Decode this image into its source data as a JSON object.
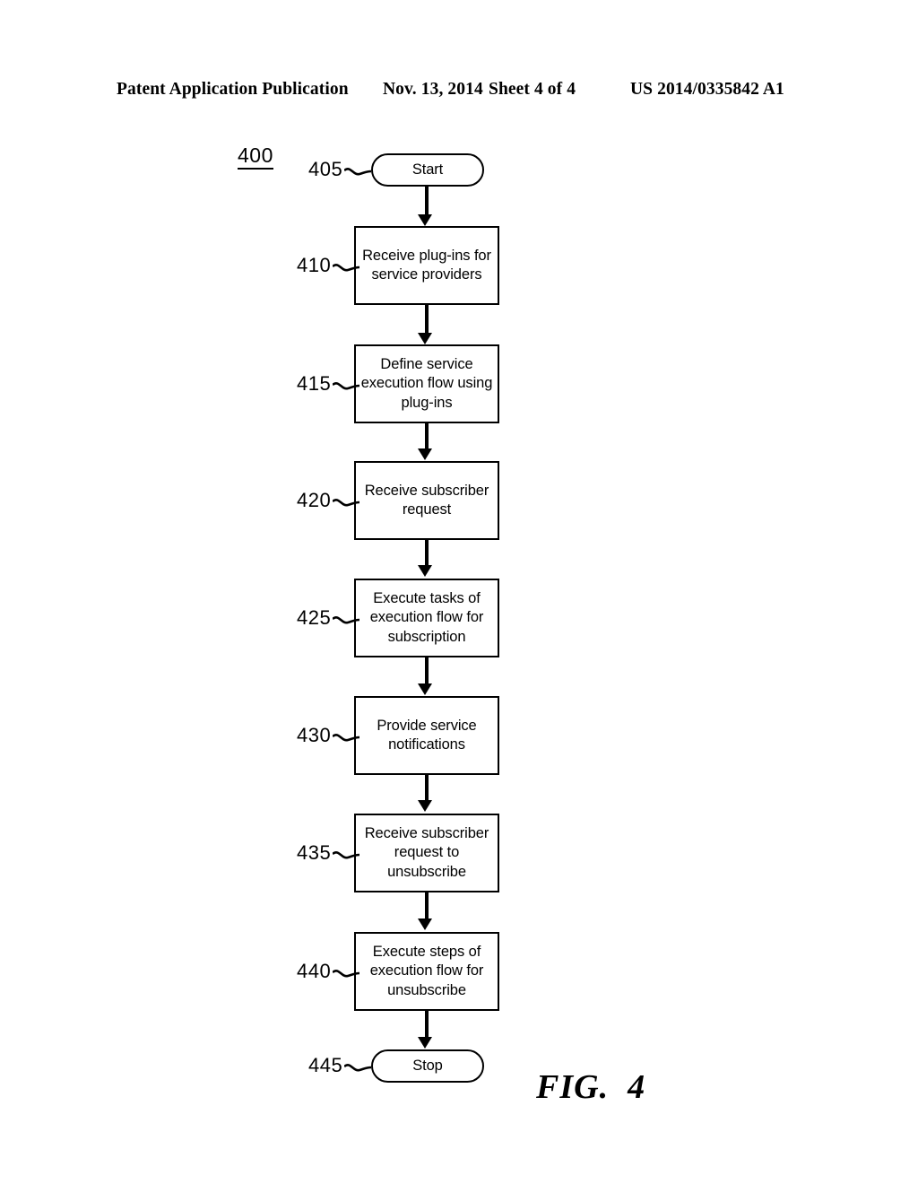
{
  "header": {
    "publication": "Patent Application Publication",
    "date": "Nov. 13, 2014",
    "sheet": "Sheet 4 of 4",
    "patent_number": "US 2014/0335842 A1"
  },
  "figure": {
    "reference": "400",
    "caption": "FIG.  4"
  },
  "flowchart": {
    "type": "flowchart",
    "orientation": "vertical",
    "nodes": [
      {
        "ref": "405",
        "shape": "terminator",
        "label": "Start"
      },
      {
        "ref": "410",
        "shape": "process",
        "label": "Receive plug-ins for service providers"
      },
      {
        "ref": "415",
        "shape": "process",
        "label": "Define service execution flow using plug-ins"
      },
      {
        "ref": "420",
        "shape": "process",
        "label": "Receive subscriber request"
      },
      {
        "ref": "425",
        "shape": "process",
        "label": "Execute tasks of execution flow for subscription"
      },
      {
        "ref": "430",
        "shape": "process",
        "label": "Provide service notifications"
      },
      {
        "ref": "435",
        "shape": "process",
        "label": "Receive subscriber request to unsubscribe"
      },
      {
        "ref": "440",
        "shape": "process",
        "label": "Execute steps of execution flow for unsubscribe"
      },
      {
        "ref": "445",
        "shape": "terminator",
        "label": "Stop"
      }
    ],
    "edges": [
      {
        "from": "405",
        "to": "410"
      },
      {
        "from": "410",
        "to": "415"
      },
      {
        "from": "415",
        "to": "420"
      },
      {
        "from": "420",
        "to": "425"
      },
      {
        "from": "425",
        "to": "430"
      },
      {
        "from": "430",
        "to": "435"
      },
      {
        "from": "435",
        "to": "440"
      },
      {
        "from": "440",
        "to": "445"
      }
    ]
  },
  "colors": {
    "ink": "#000000",
    "paper": "#ffffff"
  }
}
